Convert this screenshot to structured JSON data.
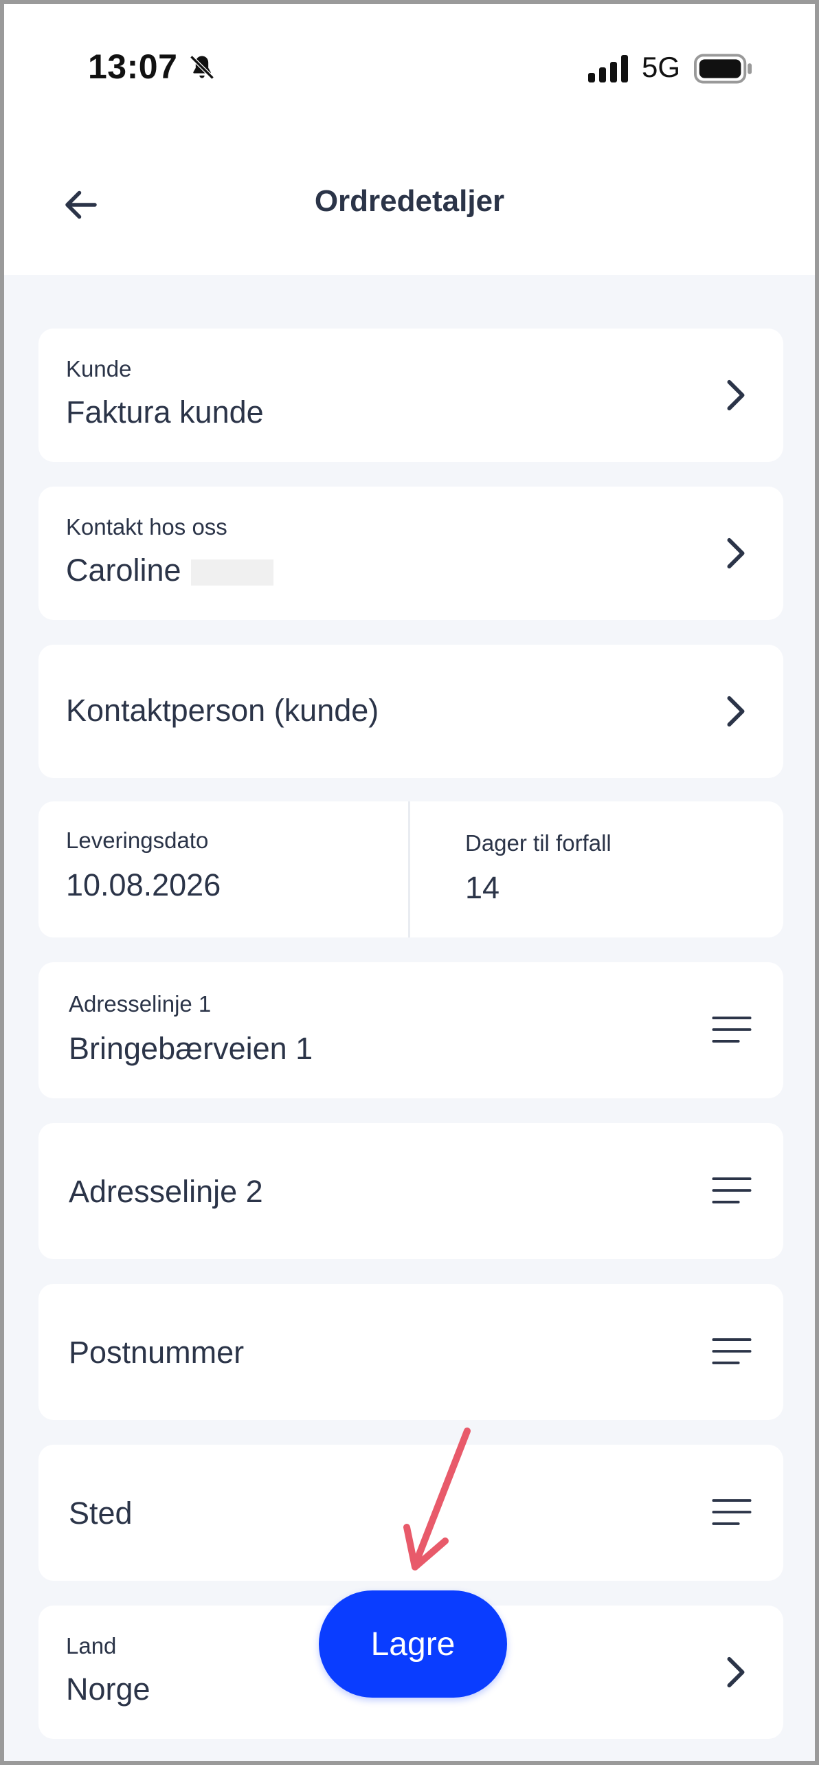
{
  "status_bar": {
    "time": "13:07",
    "network": "5G"
  },
  "header": {
    "title": "Ordredetaljer"
  },
  "fields": {
    "kunde": {
      "label": "Kunde",
      "value": "Faktura kunde"
    },
    "kontakt": {
      "label": "Kontakt hos oss",
      "value": "Caroline"
    },
    "kontaktperson": {
      "label": "Kontaktperson (kunde)"
    },
    "leveringsdato": {
      "label": "Leveringsdato",
      "value": "10.08.2026"
    },
    "forfall": {
      "label": "Dager til forfall",
      "value": "14"
    },
    "adresse1": {
      "label": "Adresselinje 1",
      "value": "Bringebærveien 1"
    },
    "adresse2": {
      "label": "Adresselinje 2"
    },
    "postnummer": {
      "label": "Postnummer"
    },
    "sted": {
      "label": "Sted"
    },
    "land": {
      "label": "Land",
      "value": "Norge"
    }
  },
  "actions": {
    "save_label": "Lagre"
  },
  "colors": {
    "accent": "#0a3dff",
    "annotation_arrow": "#e85a6a",
    "background": "#f4f6fa"
  }
}
